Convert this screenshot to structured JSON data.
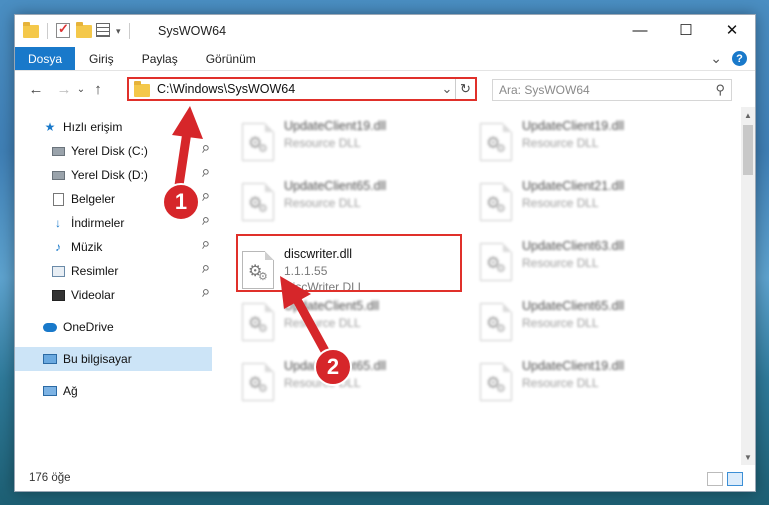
{
  "window": {
    "title": "SysWOW64",
    "controls": {
      "minimize": "—",
      "maximize": "☐",
      "close": "✕"
    }
  },
  "ribbon": {
    "tabs": [
      "Dosya",
      "Giriş",
      "Paylaş",
      "Görünüm"
    ],
    "help": "?",
    "collapse": "⌄"
  },
  "nav": {
    "back": "←",
    "forward": "→",
    "dropdown": "⌄",
    "up": "↑"
  },
  "address": {
    "path": "C:\\Windows\\SysWOW64",
    "dropdown": "⌄",
    "refresh": "↻"
  },
  "search": {
    "placeholder": "Ara: SysWOW64",
    "icon": "⚲"
  },
  "sidebar": {
    "quick_access": "Hızlı erişim",
    "items": [
      {
        "label": "Yerel Disk (C:)",
        "icon": "drive-icon"
      },
      {
        "label": "Yerel Disk (D:)",
        "icon": "drive-icon"
      },
      {
        "label": "Belgeler",
        "icon": "documents-icon"
      },
      {
        "label": "İndirmeler",
        "icon": "download-icon"
      },
      {
        "label": "Müzik",
        "icon": "music-icon"
      },
      {
        "label": "Resimler",
        "icon": "pictures-icon"
      },
      {
        "label": "Videolar",
        "icon": "videos-icon"
      }
    ],
    "onedrive": "OneDrive",
    "this_pc": "Bu bilgisayar",
    "network": "Ağ",
    "pin": "📌"
  },
  "files": {
    "left": [
      {
        "name": "UpdateClient19.dll",
        "type": "Resource DLL",
        "blurred": true
      },
      {
        "name": "UpdateClient65.dll",
        "type": "Resource DLL",
        "blurred": true
      },
      {
        "name": "discwriter.dll",
        "version": "1.1.1.55",
        "type": "DiscWriter DLL",
        "blurred": false
      },
      {
        "name": "UpdateClient5.dll",
        "type": "Resource DLL",
        "blurred": true
      },
      {
        "name": "UpdateClient65.dll",
        "type": "Resource DLL",
        "blurred": true
      }
    ],
    "right": [
      {
        "name": "UpdateClient19.dll",
        "type": "Resource DLL",
        "blurred": true
      },
      {
        "name": "UpdateClient21.dll",
        "type": "Resource DLL",
        "blurred": true
      },
      {
        "name": "UpdateClient63.dll",
        "type": "Resource DLL",
        "blurred": true
      },
      {
        "name": "UpdateClient65.dll",
        "type": "Resource DLL",
        "blurred": true
      },
      {
        "name": "UpdateClient19.dll",
        "type": "Resource DLL",
        "blurred": true
      }
    ]
  },
  "annotations": {
    "step1": "1",
    "step2": "2",
    "color": "#d6262a"
  },
  "status": {
    "count": "176 öğe"
  }
}
